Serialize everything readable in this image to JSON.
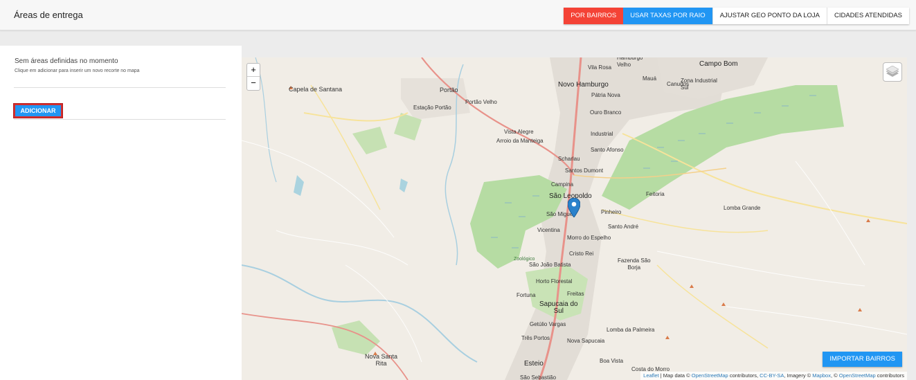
{
  "header": {
    "title": "Áreas de entrega",
    "buttons": {
      "por_bairros": "POR BAIRROS",
      "usar_taxas": "USAR TAXAS POR RAIO",
      "ajustar_geo": "AJUSTAR GEO PONTO DA LOJA",
      "cidades": "CIDADES ATENDIDAS"
    },
    "colors": {
      "red": "#f44336",
      "blue": "#2196f3"
    }
  },
  "sidebar": {
    "empty_title": "Sem áreas definidas no momento",
    "empty_subtitle": "Clique em adicionar para inserir um novo recorte no mapa",
    "add_button": "ADICIONAR"
  },
  "map": {
    "zoom_in": "+",
    "zoom_out": "−",
    "layers_icon": "layers-icon",
    "import_button": "IMPORTAR BAIRROS",
    "labels": {
      "hamburgo_velho": "Hamburgo\nVelho",
      "campo_bom": "Campo Bom",
      "vila_rosa": "Vila Rosa",
      "maua": "Mauá",
      "canudos": "Canudos",
      "zona_industrial": "Zona Industrial\nSul",
      "capela": "Capela de Santana",
      "portao": "Portão",
      "novo_hamburgo": "Novo Hamburgo",
      "patria_nova": "Pátria Nova",
      "estacao_portao": "Estação Portão",
      "portao_velho": "Portão Velho",
      "ouro_branco": "Ouro Branco",
      "vista_alegre": "Vista Alegre",
      "arroio": "Arroio da Manteiga",
      "industrial": "Industrial",
      "santo_afonso": "Santo Afonso",
      "scharlau": "Scharlau",
      "santos_dumont": "Santos Dumont",
      "campina": "Campina",
      "sao_leopoldo": "São Leopoldo",
      "feitoria": "Feitoria",
      "sao_miguel": "São Miguel",
      "pinheiro": "Pinheiro",
      "lomba_grande": "Lomba Grande",
      "vicentina": "Vicentina",
      "santo_andre": "Santo André",
      "morro_espelho": "Morro do Espelho",
      "cristo_rei": "Cristo Rei",
      "zoologico": "Zoológico",
      "sao_joao": "São João Batista",
      "fazenda": "Fazenda São\nBorja",
      "horto": "Horto Florestal",
      "fortuna": "Fortuna",
      "freitas": "Freitas",
      "sapucaia": "Sapucaia do\nSul",
      "getulio": "Getúlio Vargas",
      "lomba_palmeira": "Lomba da Palmeira",
      "tres_portos": "Três Portos",
      "nova_sapucaia": "Nova Sapucaia",
      "nova_santa_rita": "Nova Santa\nRita",
      "esteio": "Esteio",
      "boa_vista": "Boa Vista",
      "costa_morro": "Costa do Morro",
      "sao_sebastiao": "São Sebastião"
    },
    "attribution": {
      "leaflet": "Leaflet",
      "sep1": " | Map data © ",
      "osm": "OpenStreetMap",
      "contrib": " contributors, ",
      "ccbysa": "CC-BY-SA",
      "imagery": ", Imagery © ",
      "mapbox": "Mapbox",
      "sep2": ", © ",
      "osm2": "OpenStreetMap",
      "contrib2": " contributors"
    }
  }
}
